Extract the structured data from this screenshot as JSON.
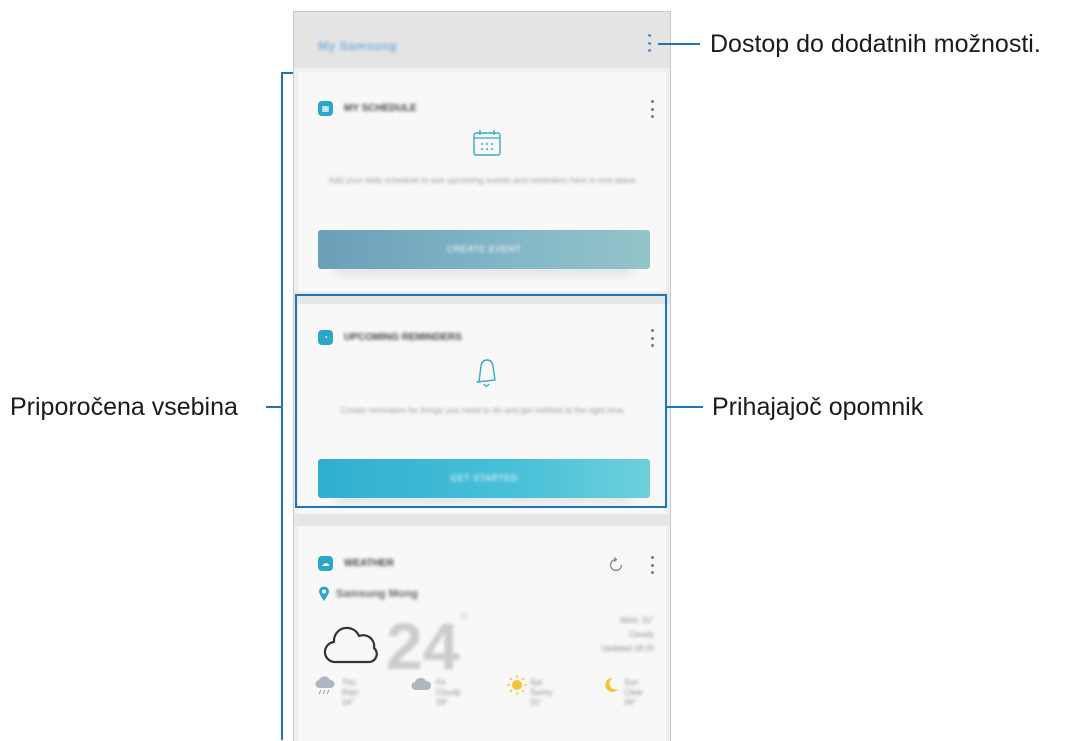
{
  "annotations": {
    "more_options": "Dostop do dodatnih možnosti.",
    "recommended_content": "Priporočena vsebina",
    "upcoming_reminder": "Prihajajoč opomnik"
  },
  "header": {
    "title": "My Samsung"
  },
  "cards": {
    "schedule": {
      "title": "MY SCHEDULE",
      "body": "Add your daily schedule to see upcoming events and reminders here in one place.",
      "button": "CREATE EVENT"
    },
    "reminders": {
      "title": "UPCOMING REMINDERS",
      "body": "Create reminders for things you need to do and get notified at the right time.",
      "button": "GET STARTED"
    },
    "weather": {
      "title": "WEATHER",
      "location": "Samsung Mong",
      "temperature": "24",
      "unit": "°",
      "details": [
        "MAX: 31°",
        "Cloudy",
        "Updated 18:25"
      ],
      "forecast": [
        {
          "icon": "rain-cloud-icon",
          "lines": [
            "Thu",
            "Rain",
            "24°"
          ]
        },
        {
          "icon": "cloud-icon",
          "lines": [
            "Fri",
            "Cloudy",
            "29°"
          ]
        },
        {
          "icon": "sun-icon",
          "lines": [
            "Sat",
            "Sunny",
            "31°"
          ]
        },
        {
          "icon": "moon-icon",
          "lines": [
            "Sun",
            "Clear",
            "26°"
          ]
        }
      ]
    }
  },
  "colors": {
    "annotation_blue": "#1f73b7",
    "schedule_button": "#6aa3b8",
    "reminder_button": "#3cbad4",
    "sun": "#f5c23a",
    "moon": "#f2c531"
  }
}
